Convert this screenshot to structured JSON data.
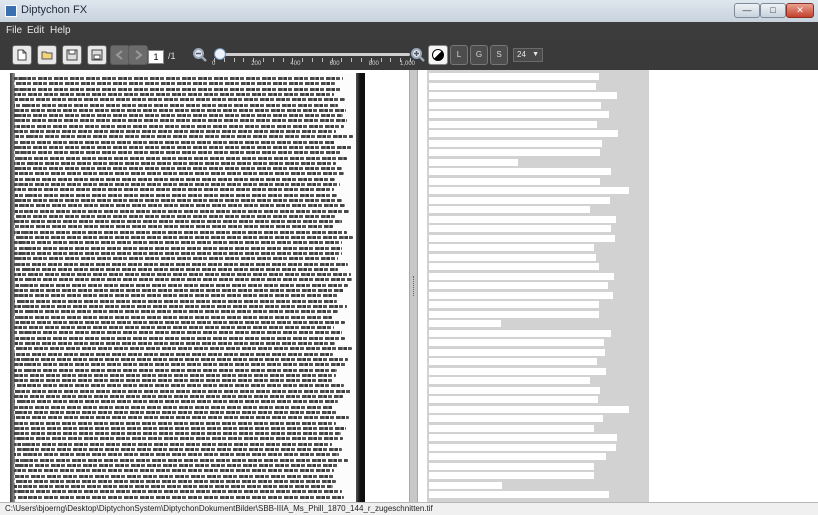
{
  "window": {
    "title": "Diptychon FX",
    "controls": [
      "minimize",
      "maximize",
      "close"
    ]
  },
  "menu": {
    "items": [
      "File",
      "Edit",
      "Help"
    ]
  },
  "toolbar": {
    "buttons": [
      {
        "name": "new-document",
        "icon": "document-icon",
        "enabled": true
      },
      {
        "name": "open-folder",
        "icon": "folder-icon",
        "enabled": true
      },
      {
        "name": "save",
        "icon": "save-icon",
        "enabled": true
      },
      {
        "name": "save-as",
        "icon": "save-as-icon",
        "enabled": true
      },
      {
        "name": "previous-page",
        "icon": "arrow-left-icon",
        "enabled": false
      },
      {
        "name": "next-page",
        "icon": "arrow-right-icon",
        "enabled": false
      }
    ],
    "page_current": "1",
    "page_total": "/1",
    "zoom": {
      "value": 0,
      "min": 0,
      "max": 1000,
      "tick_labels": [
        "0",
        "200",
        "400",
        "600",
        "800",
        "1,000"
      ]
    },
    "mode_buttons": [
      "L",
      "G",
      "S"
    ],
    "line_value": "24"
  },
  "status": {
    "path": "C:\\Users\\bjoerng\\Desktop\\DiptychonSystem\\DiptychonDokumentBilder\\SBB-IIIA_Ms_Phill_1870_144_r_zugeschnitten.tif"
  },
  "colors": {
    "menubar": "#3c3c3c",
    "toolbar": "#3a3a3a",
    "right_column": "#d2d2d2"
  }
}
